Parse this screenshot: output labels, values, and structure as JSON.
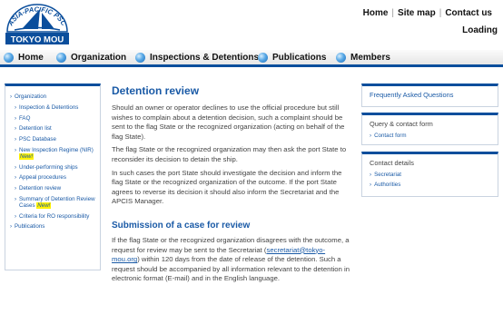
{
  "logo": {
    "arc_text": "ASIA-PACIFIC PSC",
    "name": "TOKYO MOU"
  },
  "top_links": [
    "Home",
    "Site map",
    "Contact us"
  ],
  "loading": "Loading",
  "nav": [
    "Home",
    "Organization",
    "Inspections & Detentions",
    "Publications",
    "Members"
  ],
  "sidebar": {
    "items": [
      {
        "label": "Organization",
        "sub": false
      },
      {
        "label": "Inspection & Detentions",
        "sub": true
      },
      {
        "label": "FAQ",
        "sub": true
      },
      {
        "label": "Detention list",
        "sub": true
      },
      {
        "label": "PSC Database",
        "sub": true
      },
      {
        "label": "New Inspection Regime (NIR)",
        "sub": true,
        "new": "New!"
      },
      {
        "label": "Under-performing ships",
        "sub": true
      },
      {
        "label": "Appeal procedures",
        "sub": true
      },
      {
        "label": "Detention review",
        "sub": true
      },
      {
        "label": "Summary of Detention Review Cases",
        "sub": true,
        "new": "New!"
      },
      {
        "label": "Criteria for RO responsibility",
        "sub": true
      },
      {
        "label": "Publications",
        "sub": false
      }
    ]
  },
  "main": {
    "title": "Detention review",
    "p1": "Should an owner or operator declines to use the official procedure but still wishes to complain about a detention decision, such a complaint should be sent to the flag State or the recognized organization (acting on behalf of the flag State).",
    "p2": "The flag State or the recognized organization may then ask the port State to reconsider its decision to detain the ship.",
    "p3": "In such cases the port State should investigate the decision and inform the flag State or the recognized organization of the outcome. If the port State agrees to reverse its decision it should also inform the Secretariat and the APCIS Manager.",
    "subtitle": "Submission of a case for review",
    "p4_before": "If the flag State or the recognized organization disagrees with the outcome, a request for review may be sent to the Secretariat (",
    "p4_email": "secretariat@tokyo-mou.org",
    "p4_after": ") within 120 days from the date of release of the detention. Such a request should be accompanied by all information relevant to the detention in electronic format (E-mail) and in the English language."
  },
  "right": {
    "faq": "Frequently Asked Questions",
    "query_title": "Query & contact form",
    "contact_form": "Contact form",
    "contact_details": "Contact details",
    "secretariat": "Secretariat",
    "authorities": "Authorities"
  },
  "colors": {
    "accent": "#0b4e9c",
    "link": "#1a5aa6",
    "new_highlight": "#fff200"
  }
}
